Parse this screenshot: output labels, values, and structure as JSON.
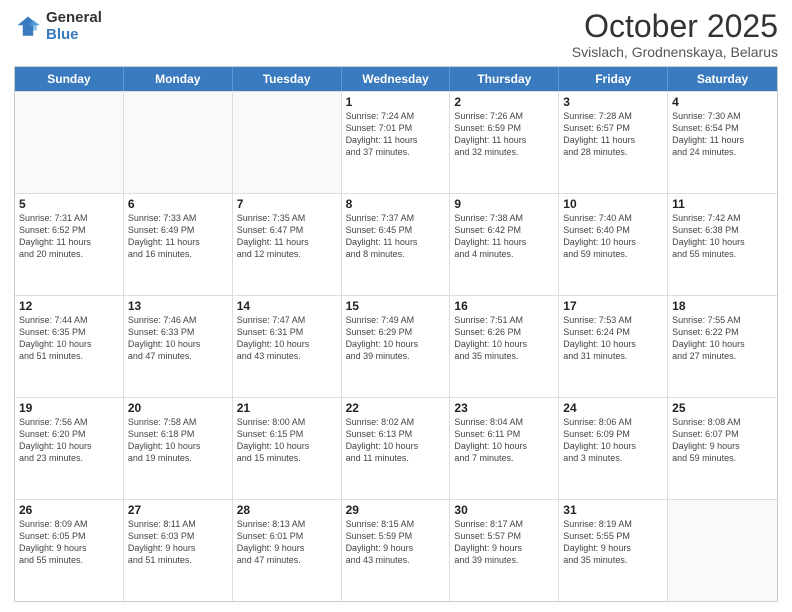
{
  "logo": {
    "general": "General",
    "blue": "Blue"
  },
  "header": {
    "month": "October 2025",
    "location": "Svislach, Grodnenskaya, Belarus"
  },
  "weekdays": [
    "Sunday",
    "Monday",
    "Tuesday",
    "Wednesday",
    "Thursday",
    "Friday",
    "Saturday"
  ],
  "rows": [
    [
      {
        "day": "",
        "lines": []
      },
      {
        "day": "",
        "lines": []
      },
      {
        "day": "",
        "lines": []
      },
      {
        "day": "1",
        "lines": [
          "Sunrise: 7:24 AM",
          "Sunset: 7:01 PM",
          "Daylight: 11 hours",
          "and 37 minutes."
        ]
      },
      {
        "day": "2",
        "lines": [
          "Sunrise: 7:26 AM",
          "Sunset: 6:59 PM",
          "Daylight: 11 hours",
          "and 32 minutes."
        ]
      },
      {
        "day": "3",
        "lines": [
          "Sunrise: 7:28 AM",
          "Sunset: 6:57 PM",
          "Daylight: 11 hours",
          "and 28 minutes."
        ]
      },
      {
        "day": "4",
        "lines": [
          "Sunrise: 7:30 AM",
          "Sunset: 6:54 PM",
          "Daylight: 11 hours",
          "and 24 minutes."
        ]
      }
    ],
    [
      {
        "day": "5",
        "lines": [
          "Sunrise: 7:31 AM",
          "Sunset: 6:52 PM",
          "Daylight: 11 hours",
          "and 20 minutes."
        ]
      },
      {
        "day": "6",
        "lines": [
          "Sunrise: 7:33 AM",
          "Sunset: 6:49 PM",
          "Daylight: 11 hours",
          "and 16 minutes."
        ]
      },
      {
        "day": "7",
        "lines": [
          "Sunrise: 7:35 AM",
          "Sunset: 6:47 PM",
          "Daylight: 11 hours",
          "and 12 minutes."
        ]
      },
      {
        "day": "8",
        "lines": [
          "Sunrise: 7:37 AM",
          "Sunset: 6:45 PM",
          "Daylight: 11 hours",
          "and 8 minutes."
        ]
      },
      {
        "day": "9",
        "lines": [
          "Sunrise: 7:38 AM",
          "Sunset: 6:42 PM",
          "Daylight: 11 hours",
          "and 4 minutes."
        ]
      },
      {
        "day": "10",
        "lines": [
          "Sunrise: 7:40 AM",
          "Sunset: 6:40 PM",
          "Daylight: 10 hours",
          "and 59 minutes."
        ]
      },
      {
        "day": "11",
        "lines": [
          "Sunrise: 7:42 AM",
          "Sunset: 6:38 PM",
          "Daylight: 10 hours",
          "and 55 minutes."
        ]
      }
    ],
    [
      {
        "day": "12",
        "lines": [
          "Sunrise: 7:44 AM",
          "Sunset: 6:35 PM",
          "Daylight: 10 hours",
          "and 51 minutes."
        ]
      },
      {
        "day": "13",
        "lines": [
          "Sunrise: 7:46 AM",
          "Sunset: 6:33 PM",
          "Daylight: 10 hours",
          "and 47 minutes."
        ]
      },
      {
        "day": "14",
        "lines": [
          "Sunrise: 7:47 AM",
          "Sunset: 6:31 PM",
          "Daylight: 10 hours",
          "and 43 minutes."
        ]
      },
      {
        "day": "15",
        "lines": [
          "Sunrise: 7:49 AM",
          "Sunset: 6:29 PM",
          "Daylight: 10 hours",
          "and 39 minutes."
        ]
      },
      {
        "day": "16",
        "lines": [
          "Sunrise: 7:51 AM",
          "Sunset: 6:26 PM",
          "Daylight: 10 hours",
          "and 35 minutes."
        ]
      },
      {
        "day": "17",
        "lines": [
          "Sunrise: 7:53 AM",
          "Sunset: 6:24 PM",
          "Daylight: 10 hours",
          "and 31 minutes."
        ]
      },
      {
        "day": "18",
        "lines": [
          "Sunrise: 7:55 AM",
          "Sunset: 6:22 PM",
          "Daylight: 10 hours",
          "and 27 minutes."
        ]
      }
    ],
    [
      {
        "day": "19",
        "lines": [
          "Sunrise: 7:56 AM",
          "Sunset: 6:20 PM",
          "Daylight: 10 hours",
          "and 23 minutes."
        ]
      },
      {
        "day": "20",
        "lines": [
          "Sunrise: 7:58 AM",
          "Sunset: 6:18 PM",
          "Daylight: 10 hours",
          "and 19 minutes."
        ]
      },
      {
        "day": "21",
        "lines": [
          "Sunrise: 8:00 AM",
          "Sunset: 6:15 PM",
          "Daylight: 10 hours",
          "and 15 minutes."
        ]
      },
      {
        "day": "22",
        "lines": [
          "Sunrise: 8:02 AM",
          "Sunset: 6:13 PM",
          "Daylight: 10 hours",
          "and 11 minutes."
        ]
      },
      {
        "day": "23",
        "lines": [
          "Sunrise: 8:04 AM",
          "Sunset: 6:11 PM",
          "Daylight: 10 hours",
          "and 7 minutes."
        ]
      },
      {
        "day": "24",
        "lines": [
          "Sunrise: 8:06 AM",
          "Sunset: 6:09 PM",
          "Daylight: 10 hours",
          "and 3 minutes."
        ]
      },
      {
        "day": "25",
        "lines": [
          "Sunrise: 8:08 AM",
          "Sunset: 6:07 PM",
          "Daylight: 9 hours",
          "and 59 minutes."
        ]
      }
    ],
    [
      {
        "day": "26",
        "lines": [
          "Sunrise: 8:09 AM",
          "Sunset: 6:05 PM",
          "Daylight: 9 hours",
          "and 55 minutes."
        ]
      },
      {
        "day": "27",
        "lines": [
          "Sunrise: 8:11 AM",
          "Sunset: 6:03 PM",
          "Daylight: 9 hours",
          "and 51 minutes."
        ]
      },
      {
        "day": "28",
        "lines": [
          "Sunrise: 8:13 AM",
          "Sunset: 6:01 PM",
          "Daylight: 9 hours",
          "and 47 minutes."
        ]
      },
      {
        "day": "29",
        "lines": [
          "Sunrise: 8:15 AM",
          "Sunset: 5:59 PM",
          "Daylight: 9 hours",
          "and 43 minutes."
        ]
      },
      {
        "day": "30",
        "lines": [
          "Sunrise: 8:17 AM",
          "Sunset: 5:57 PM",
          "Daylight: 9 hours",
          "and 39 minutes."
        ]
      },
      {
        "day": "31",
        "lines": [
          "Sunrise: 8:19 AM",
          "Sunset: 5:55 PM",
          "Daylight: 9 hours",
          "and 35 minutes."
        ]
      },
      {
        "day": "",
        "lines": []
      }
    ]
  ]
}
